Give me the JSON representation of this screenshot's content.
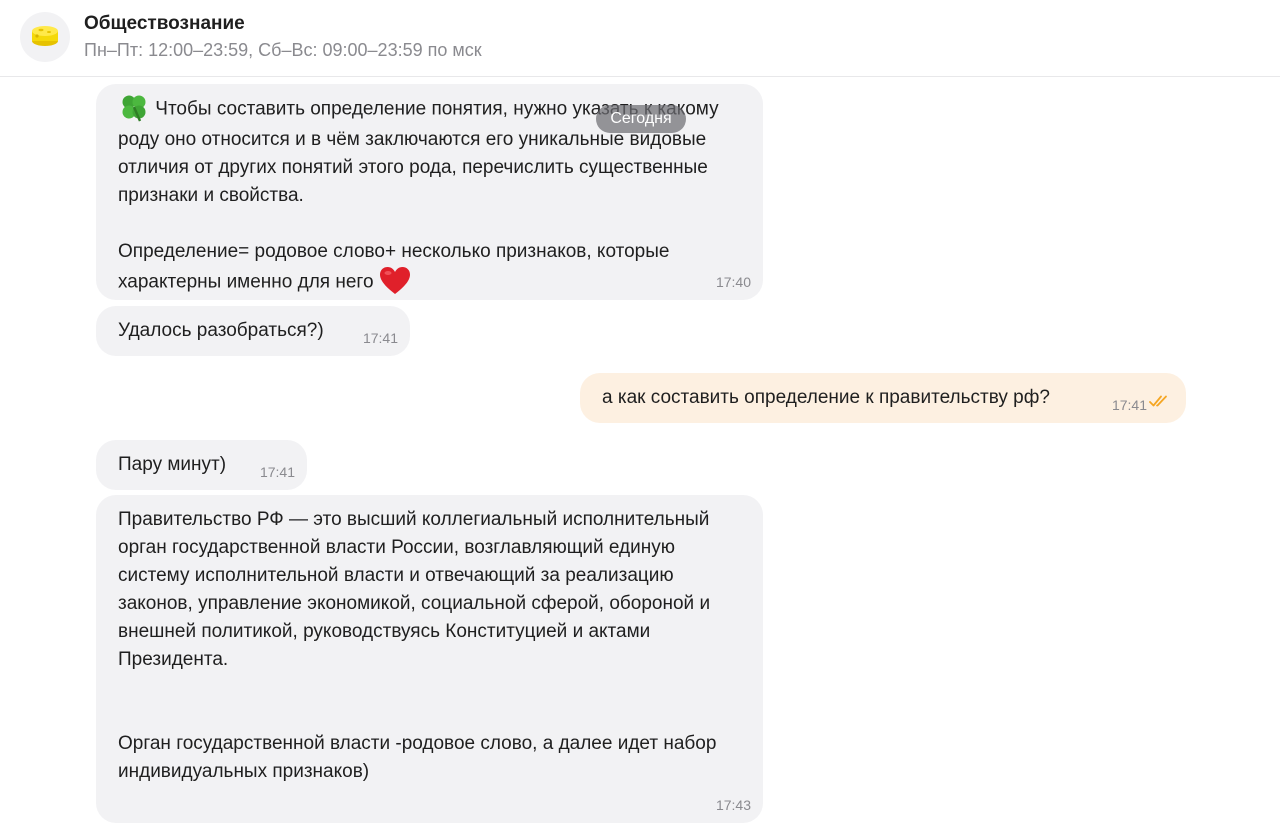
{
  "header": {
    "title": "Обществознание",
    "subtitle": "Пн–Пт: 12:00–23:59, Сб–Вс: 09:00–23:59 по мск",
    "avatar_icon": "cheese-icon"
  },
  "date_divider": "Сегодня",
  "messages": [
    {
      "direction": "incoming",
      "emoji_start": "four-leaf-clover-icon",
      "text_p1": "Чтобы составить определение понятия, нужно указать к какому роду оно относится и в чём заключаются его уникальные видовые отличия от других понятий этого рода, перечислить существенные признаки и свойства.",
      "text_p2": "Определение= родовое слово+ несколько признаков, которые характерны именно для него",
      "emoji_end": "red-heart-icon",
      "time": "17:40"
    },
    {
      "direction": "incoming",
      "text": "Удалось разобраться?)",
      "time": "17:41"
    },
    {
      "direction": "outgoing",
      "text": "а как составить определение к правительству рф?",
      "time": "17:41",
      "status_icon": "double-check-icon"
    },
    {
      "direction": "incoming",
      "text": "Пару минут)",
      "time": "17:41"
    },
    {
      "direction": "incoming",
      "text_p1": "Правительство РФ — это высший коллегиальный исполнительный орган государственной власти России, возглавляющий единую систему исполнительной власти и отвечающий за реализацию законов, управление экономикой, социальной сферой, обороной и внешней политикой, руководствуясь Конституцией и актами Президента.",
      "text_p2": "Орган государственной власти -родовое слово, а далее идет набор индивидуальных признаков)",
      "time": "17:43"
    }
  ],
  "colors": {
    "incoming_bubble": "#f2f2f4",
    "outgoing_bubble": "#fdf0e1",
    "check_accent": "#f5a623",
    "heart": "#e0202a",
    "clover": "#3fa535"
  }
}
